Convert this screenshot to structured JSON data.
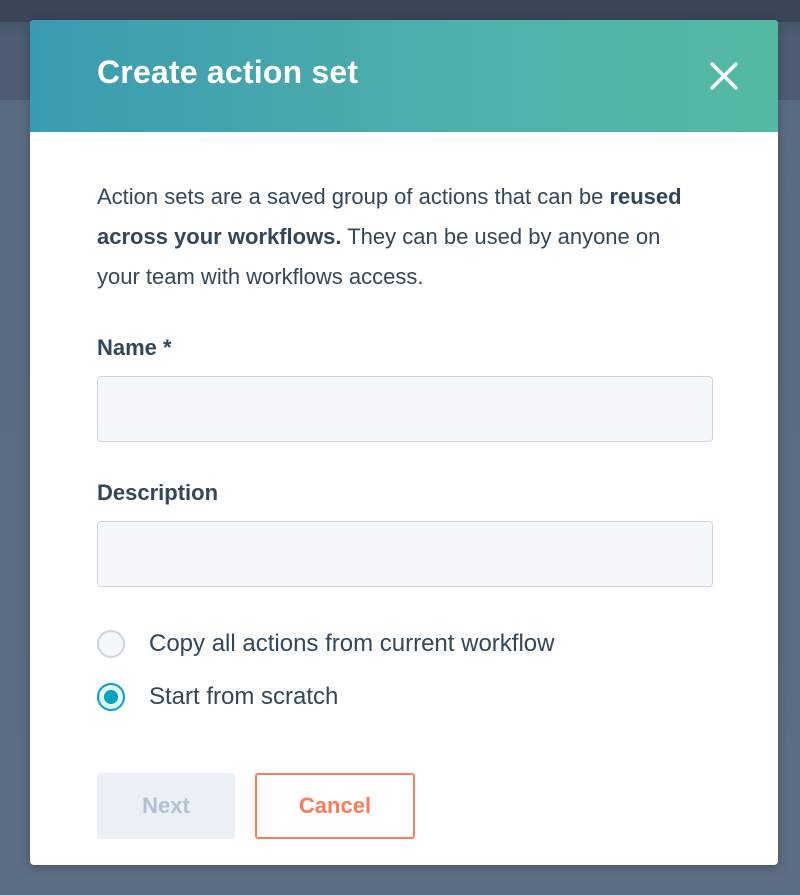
{
  "modal": {
    "title": "Create action set",
    "close_icon": "close-icon",
    "intro_prefix": "Action sets are a saved group of actions that can be ",
    "intro_bold": "reused across your workflows.",
    "intro_suffix": " They can be used by anyone on your team with workflows access.",
    "fields": {
      "name": {
        "label": "Name *",
        "value": "",
        "placeholder": ""
      },
      "description": {
        "label": "Description",
        "value": "",
        "placeholder": ""
      }
    },
    "options": [
      {
        "label": "Copy all actions from current workflow",
        "selected": false
      },
      {
        "label": "Start from scratch",
        "selected": true
      }
    ],
    "buttons": {
      "next": "Next",
      "cancel": "Cancel"
    }
  },
  "colors": {
    "header_gradient_start": "#3a9bb0",
    "header_gradient_end": "#54b9a2",
    "text": "#33475b",
    "accent_radio": "#00a4bd",
    "cancel": "#ff7a59",
    "next_disabled_bg": "#eaf0f6",
    "next_disabled_text": "#b0c1d4"
  }
}
